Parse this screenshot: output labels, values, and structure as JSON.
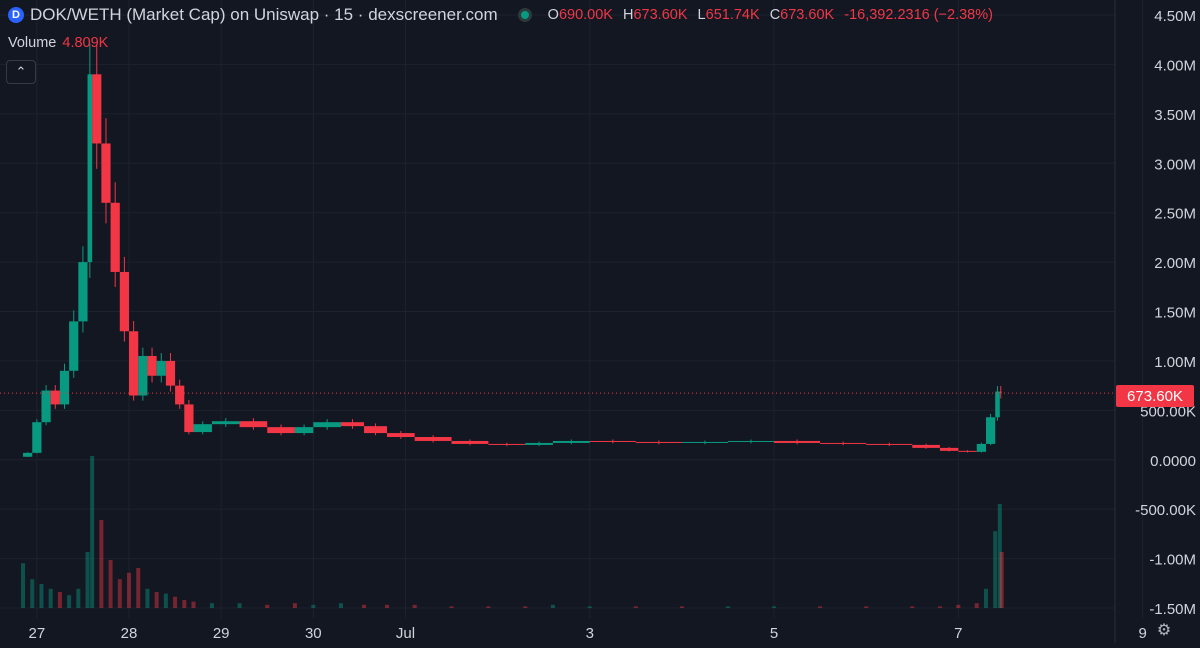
{
  "header": {
    "title": "DOK/WETH (Market Cap) on Uniswap · 15 · dexscreener.com",
    "ohlc": [
      {
        "key": "O",
        "value": "690.00K"
      },
      {
        "key": "H",
        "value": "673.60K"
      },
      {
        "key": "L",
        "value": "651.74K"
      },
      {
        "key": "C",
        "value": "673.60K"
      }
    ],
    "change": "-16,392.2316 (−2.38%)",
    "volume_label": "Volume",
    "volume_value": "4.809K",
    "collapse_icon": "chevron-up-icon"
  },
  "colors": {
    "background": "#131722",
    "up": "#089981",
    "down": "#f23645",
    "grid": "#1e222d",
    "text": "#d1d4dc"
  },
  "chart_data": {
    "type": "candlestick",
    "y_ticks": [
      "4.50M",
      "4.00M",
      "3.50M",
      "3.00M",
      "2.50M",
      "2.00M",
      "1.50M",
      "1.00M",
      "500.00K",
      "0.0000",
      "-500.00K",
      "-1.00M",
      "-1.50M"
    ],
    "y_tick_values": [
      4500000,
      4000000,
      3500000,
      3000000,
      2500000,
      2000000,
      1500000,
      1000000,
      500000,
      0,
      -500000,
      -1000000,
      -1500000
    ],
    "x_ticks": [
      "27",
      "28",
      "29",
      "30",
      "Jul",
      "3",
      "5",
      "7",
      "9"
    ],
    "x_tick_days": [
      27,
      28,
      29,
      30,
      31,
      33,
      35,
      37,
      39
    ],
    "ylim": [
      -1500000,
      4500000
    ],
    "xlim_days": [
      26.6,
      38.7
    ],
    "last_price_label": "673.60K",
    "last_price_value": 673600,
    "grid": true,
    "series": [
      {
        "points": [
          [
            26.85,
            30000
          ],
          [
            26.95,
            70000
          ],
          [
            27.05,
            380000
          ],
          [
            27.15,
            700000
          ],
          [
            27.25,
            560000
          ],
          [
            27.35,
            900000
          ],
          [
            27.45,
            1400000
          ],
          [
            27.55,
            2000000
          ],
          [
            27.6,
            3900000
          ],
          [
            27.7,
            3200000
          ],
          [
            27.8,
            2600000
          ],
          [
            27.9,
            1900000
          ],
          [
            28.0,
            1300000
          ],
          [
            28.1,
            650000
          ],
          [
            28.2,
            1050000
          ],
          [
            28.3,
            850000
          ],
          [
            28.4,
            1000000
          ],
          [
            28.5,
            750000
          ],
          [
            28.6,
            560000
          ],
          [
            28.7,
            280000
          ],
          [
            28.9,
            360000
          ],
          [
            29.2,
            390000
          ],
          [
            29.5,
            330000
          ],
          [
            29.8,
            270000
          ],
          [
            30.0,
            330000
          ],
          [
            30.3,
            380000
          ],
          [
            30.55,
            340000
          ],
          [
            30.8,
            270000
          ],
          [
            31.1,
            230000
          ],
          [
            31.5,
            190000
          ],
          [
            31.9,
            160000
          ],
          [
            32.3,
            150000
          ],
          [
            32.6,
            170000
          ],
          [
            33.0,
            190000
          ],
          [
            33.5,
            180000
          ],
          [
            34.0,
            170000
          ],
          [
            34.5,
            180000
          ],
          [
            35.0,
            190000
          ],
          [
            35.5,
            170000
          ],
          [
            36.0,
            160000
          ],
          [
            36.5,
            150000
          ],
          [
            36.8,
            120000
          ],
          [
            37.0,
            90000
          ],
          [
            37.2,
            80000
          ],
          [
            37.3,
            160000
          ],
          [
            37.4,
            430000
          ],
          [
            37.45,
            690000
          ],
          [
            37.47,
            673600
          ]
        ]
      }
    ],
    "volume": [
      [
        26.85,
        0.28
      ],
      [
        26.95,
        0.18
      ],
      [
        27.05,
        0.15
      ],
      [
        27.15,
        0.12
      ],
      [
        27.25,
        0.1
      ],
      [
        27.35,
        0.08
      ],
      [
        27.45,
        0.12
      ],
      [
        27.55,
        0.35
      ],
      [
        27.6,
        0.95
      ],
      [
        27.7,
        0.55
      ],
      [
        27.8,
        0.3
      ],
      [
        27.9,
        0.18
      ],
      [
        28.0,
        0.22
      ],
      [
        28.1,
        0.25
      ],
      [
        28.2,
        0.12
      ],
      [
        28.3,
        0.1
      ],
      [
        28.4,
        0.09
      ],
      [
        28.5,
        0.07
      ],
      [
        28.6,
        0.05
      ],
      [
        28.7,
        0.04
      ],
      [
        28.9,
        0.03
      ],
      [
        29.2,
        0.03
      ],
      [
        29.5,
        0.02
      ],
      [
        29.8,
        0.03
      ],
      [
        30.0,
        0.02
      ],
      [
        30.3,
        0.03
      ],
      [
        30.55,
        0.02
      ],
      [
        30.8,
        0.02
      ],
      [
        31.1,
        0.02
      ],
      [
        31.5,
        0.01
      ],
      [
        31.9,
        0.01
      ],
      [
        32.3,
        0.01
      ],
      [
        32.6,
        0.02
      ],
      [
        33.0,
        0.01
      ],
      [
        33.5,
        0.01
      ],
      [
        34.0,
        0.01
      ],
      [
        34.5,
        0.01
      ],
      [
        35.0,
        0.01
      ],
      [
        35.5,
        0.01
      ],
      [
        36.0,
        0.01
      ],
      [
        36.5,
        0.01
      ],
      [
        36.8,
        0.01
      ],
      [
        37.0,
        0.02
      ],
      [
        37.2,
        0.03
      ],
      [
        37.3,
        0.12
      ],
      [
        37.4,
        0.48
      ],
      [
        37.45,
        0.65
      ],
      [
        37.47,
        0.35
      ]
    ]
  },
  "footer": {
    "settings_icon": "gear-icon"
  }
}
